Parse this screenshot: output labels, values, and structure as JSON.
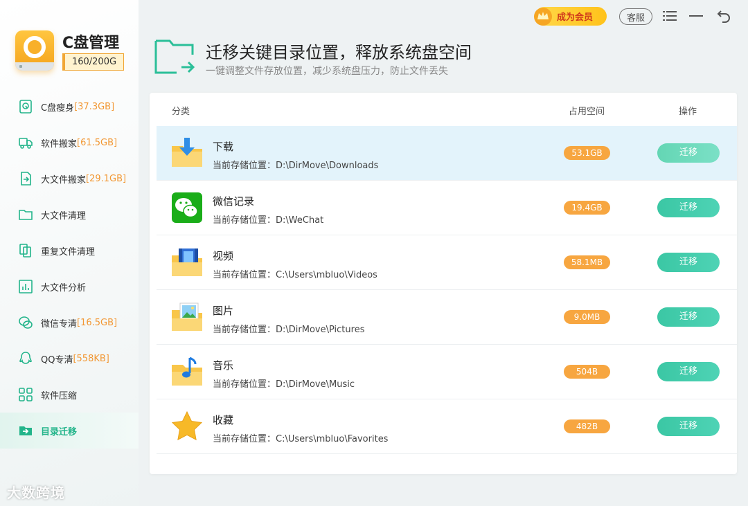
{
  "app": {
    "title": "C盘管理",
    "capacity": "160/200G"
  },
  "sidebar": {
    "items": [
      {
        "label": "C盘瘦身",
        "tag": "[37.3GB]",
        "icon": "disk-slim-icon"
      },
      {
        "label": "软件搬家",
        "tag": "[61.5GB]",
        "icon": "truck-icon"
      },
      {
        "label": "大文件搬家",
        "tag": "[29.1GB]",
        "icon": "file-move-icon"
      },
      {
        "label": "大文件清理",
        "tag": "",
        "icon": "folder-icon"
      },
      {
        "label": "重复文件清理",
        "tag": "",
        "icon": "duplicate-file-icon"
      },
      {
        "label": "大文件分析",
        "tag": "",
        "icon": "bar-chart-icon"
      },
      {
        "label": "微信专清",
        "tag": "[16.5GB]",
        "icon": "wechat-icon"
      },
      {
        "label": "QQ专清",
        "tag": "[558KB]",
        "icon": "qq-icon"
      },
      {
        "label": "软件压缩",
        "tag": "",
        "icon": "grid-icon"
      },
      {
        "label": "目录迁移",
        "tag": "",
        "icon": "folder-arrow-icon"
      }
    ]
  },
  "topbar": {
    "vip_label": "成为会员",
    "service_label": "客服"
  },
  "header": {
    "title": "迁移关键目录位置，释放系统盘空间",
    "subtitle": "一键调整文件存放位置，减少系统盘压力，防止文件丢失"
  },
  "table": {
    "columns": {
      "category": "分类",
      "space": "占用空间",
      "action": "操作"
    },
    "loc_prefix": "当前存储位置：",
    "rows": [
      {
        "name": "下载",
        "location": "D:\\DirMove\\Downloads",
        "size": "53.1GB",
        "action": "迁移",
        "icon": "download-folder-icon"
      },
      {
        "name": "微信记录",
        "location": "D:\\WeChat",
        "size": "19.4GB",
        "action": "迁移",
        "icon": "wechat-icon"
      },
      {
        "name": "视频",
        "location": "C:\\Users\\mbluo\\Videos",
        "size": "58.1MB",
        "action": "迁移",
        "icon": "video-folder-icon"
      },
      {
        "name": "图片",
        "location": "D:\\DirMove\\Pictures",
        "size": "9.0MB",
        "action": "迁移",
        "icon": "picture-folder-icon"
      },
      {
        "name": "音乐",
        "location": "D:\\DirMove\\Music",
        "size": "504B",
        "action": "迁移",
        "icon": "music-folder-icon"
      },
      {
        "name": "收藏",
        "location": "C:\\Users\\mbluo\\Favorites",
        "size": "482B",
        "action": "迁移",
        "icon": "star-icon"
      }
    ]
  },
  "watermark": "大数跨境",
  "colors": {
    "accent": "#22b48a",
    "orange": "#f7a640",
    "button": "#3bc7a4"
  }
}
